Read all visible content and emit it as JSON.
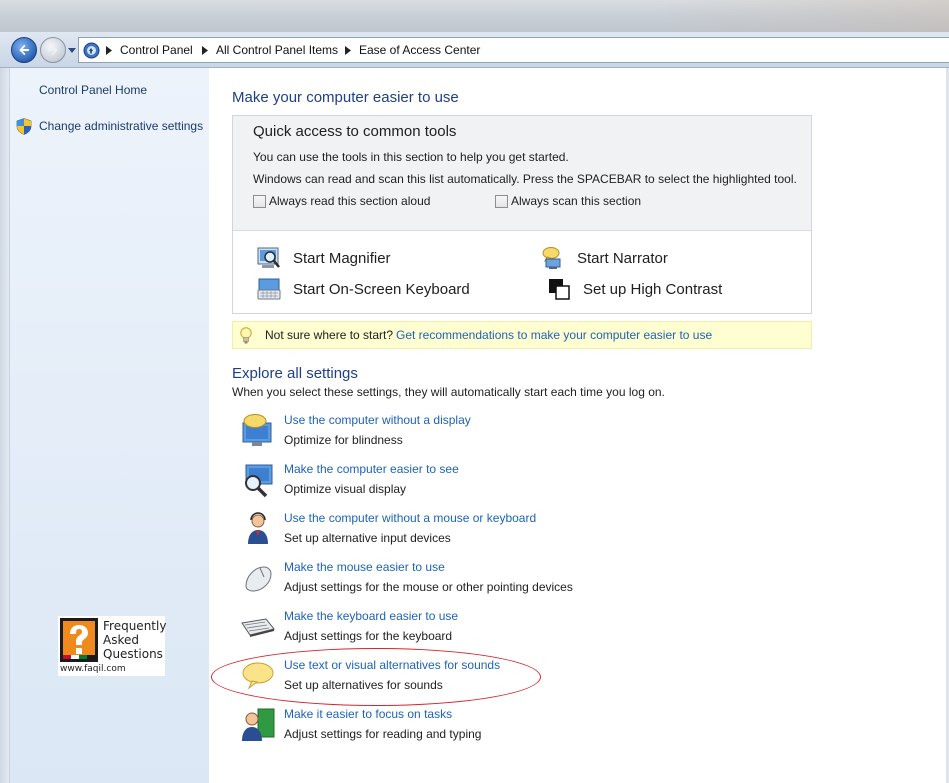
{
  "breadcrumb": [
    "Control Panel",
    "All Control Panel Items",
    "Ease of Access Center"
  ],
  "sidebar": {
    "home": "Control Panel Home",
    "admin": "Change administrative settings"
  },
  "main": {
    "title": "Make your computer easier to use",
    "quick": {
      "title": "Quick access to common tools",
      "line1": "You can use the tools in this section to help you get started.",
      "line2": "Windows can read and scan this list automatically.  Press the SPACEBAR to select the highlighted tool.",
      "check_read": "Always read this section aloud",
      "check_scan": "Always scan this section",
      "tools": [
        "Start Magnifier",
        "Start Narrator",
        "Start On-Screen Keyboard",
        "Set up High Contrast"
      ]
    },
    "tip": {
      "text": "Not sure where to start?",
      "link": "Get recommendations to make your computer easier to use"
    },
    "explore": {
      "title": "Explore all settings",
      "subtitle": "When you select these settings, they will automatically start each time you log on.",
      "items": [
        {
          "link": "Use the computer without a display",
          "desc": "Optimize for blindness",
          "icon": "display-speech-icon"
        },
        {
          "link": "Make the computer easier to see",
          "desc": "Optimize visual display",
          "icon": "magnified-display-icon"
        },
        {
          "link": "Use the computer without a mouse or keyboard",
          "desc": "Set up alternative input devices",
          "icon": "person-headset-icon"
        },
        {
          "link": "Make the mouse easier to use",
          "desc": "Adjust settings for the mouse or other pointing devices",
          "icon": "mouse-icon"
        },
        {
          "link": "Make the keyboard easier to use",
          "desc": "Adjust settings for the keyboard",
          "icon": "keyboard-icon"
        },
        {
          "link": "Use text or visual alternatives for sounds",
          "desc": "Set up alternatives for sounds",
          "icon": "speech-bubble-icon"
        },
        {
          "link": "Make it easier to focus on tasks",
          "desc": "Adjust settings for reading and typing",
          "icon": "person-task-icon"
        }
      ]
    }
  },
  "watermark": {
    "line1": "Frequently",
    "line2": "Asked",
    "line3": "Questions",
    "url": "www.faqil.com"
  },
  "colors": {
    "link": "#1d63b6",
    "heading": "#1e3f86",
    "highlight": "#d6242c"
  }
}
